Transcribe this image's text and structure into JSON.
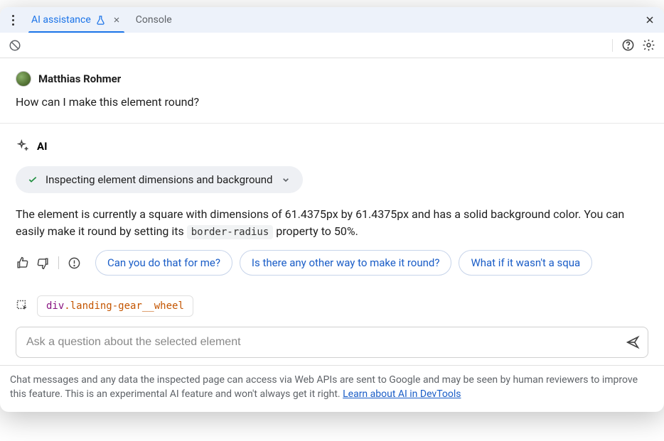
{
  "tabs": {
    "ai_assistance": "AI assistance",
    "console": "Console"
  },
  "user": {
    "name": "Matthias Rohmer",
    "message": "How can I make this element round?"
  },
  "ai": {
    "label": "AI",
    "inspect_status": "Inspecting element dimensions and background",
    "response_before": "The element is currently a square with dimensions of 61.4375px by 61.4375px and has a solid background color. You can easily make it round by setting its ",
    "code": "border-radius",
    "response_after": " property to 50%."
  },
  "suggestions": {
    "s1": "Can you do that for me?",
    "s2": "Is there any other way to make it round?",
    "s3": "What if it wasn't a squa"
  },
  "selected_element": {
    "tag": "div",
    "class": ".landing-gear__wheel"
  },
  "input": {
    "placeholder": "Ask a question about the selected element"
  },
  "footer": {
    "text": "Chat messages and any data the inspected page can access via Web APIs are sent to Google and may be seen by human reviewers to improve this feature. This is an experimental AI feature and won't always get it right. ",
    "link": "Learn about AI in DevTools"
  }
}
